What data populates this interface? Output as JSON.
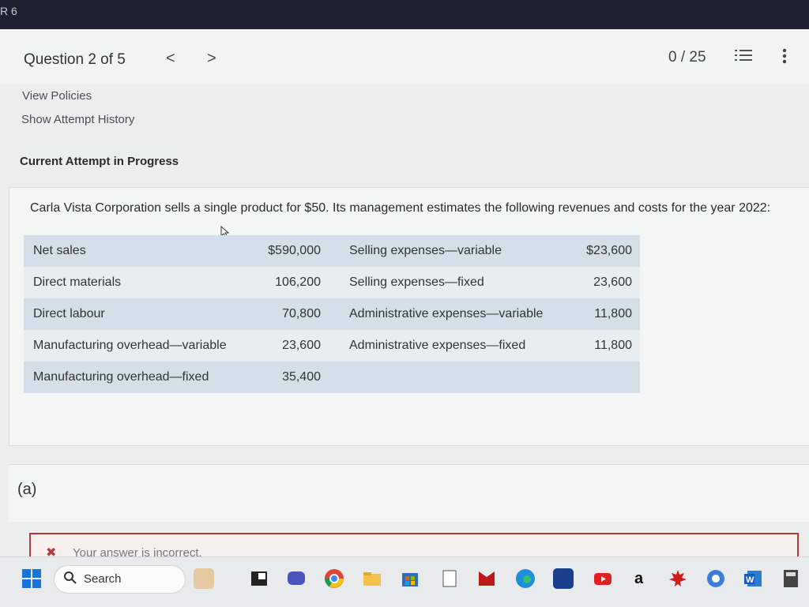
{
  "window": {
    "corner_text": "R 6"
  },
  "header": {
    "question_label": "Question 2 of 5",
    "prev_glyph": "<",
    "next_glyph": ">",
    "score": "0 / 25"
  },
  "links": {
    "view_policies": "View Policies",
    "attempt_history": "Show Attempt History"
  },
  "attempt_label": "Current Attempt in Progress",
  "problem_text": "Carla Vista Corporation sells a single product for $50. Its management estimates the following revenues and costs for the year 2022:",
  "table": {
    "rows": [
      {
        "label1": "Net sales",
        "value1": "$590,000",
        "label2": "Selling expenses—variable",
        "value2": "$23,600"
      },
      {
        "label1": "Direct materials",
        "value1": "106,200",
        "label2": "Selling expenses—fixed",
        "value2": "23,600"
      },
      {
        "label1": "Direct labour",
        "value1": "70,800",
        "label2": "Administrative expenses—variable",
        "value2": "11,800"
      },
      {
        "label1": "Manufacturing overhead—variable",
        "value1": "23,600",
        "label2": "Administrative expenses—fixed",
        "value2": "11,800"
      },
      {
        "label1": "Manufacturing overhead—fixed",
        "value1": "35,400",
        "label2": "",
        "value2": ""
      }
    ]
  },
  "part_label": "(a)",
  "feedback": {
    "text": "Your answer is incorrect."
  },
  "taskbar": {
    "search_label": "Search",
    "icons": [
      "windows-start-icon",
      "search-icon",
      "weather-icon",
      "file-explorer-icon",
      "chat-icon",
      "chrome-icon",
      "folder-icon",
      "store-icon",
      "notepad-icon",
      "mcafee-icon",
      "edge-icon",
      "rbc-icon",
      "youtube-icon",
      "amazon-icon",
      "maple-leaf-icon",
      "app-icon",
      "word-icon",
      "calculator-icon"
    ]
  },
  "colors": {
    "feedback_border": "#b23a3a",
    "table_shade": "#d4dfe8",
    "topbar": "#1d2130"
  }
}
